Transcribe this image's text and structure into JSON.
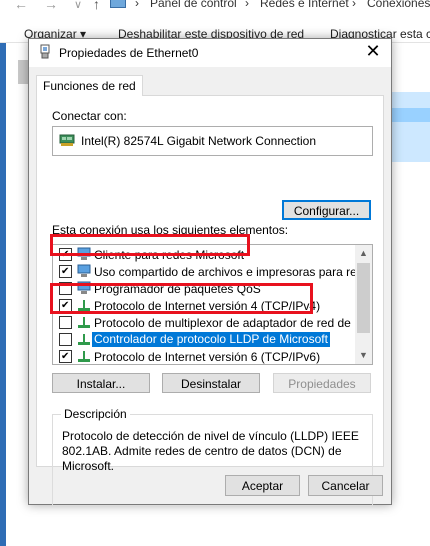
{
  "background": {
    "nav": {
      "back": "←",
      "forward": "→",
      "dropdown": "∨",
      "up": "↑"
    },
    "breadcrumb": {
      "sep1": "›",
      "item1": "Panel de control",
      "sep2": "›",
      "item2": "Redes e Internet",
      "sep3": "›",
      "item3": "Conexiones"
    },
    "toolbar": {
      "organize": "Organizar ▾",
      "disable": "Deshabilitar este dispositivo de red",
      "diagnose": "Diagnosticar esta c"
    }
  },
  "dialog": {
    "title": "Propiedades de Ethernet0",
    "close": "✕",
    "tab": "Funciones de red",
    "connect_label": "Conectar con:",
    "adapter": "Intel(R) 82574L Gigabit Network Connection",
    "configure_button": "Configurar...",
    "items_label": "Esta conexión usa los siguientes elementos:",
    "items": [
      {
        "label": "Cliente para redes Microsoft",
        "checked": true,
        "icon": "network-client-icon"
      },
      {
        "label": "Uso compartido de archivos e impresoras para redes M",
        "checked": true,
        "icon": "network-service-icon"
      },
      {
        "label": "Programador de paquetes QoS",
        "checked": false,
        "icon": "network-service-icon"
      },
      {
        "label": "Protocolo de Internet versión 4 (TCP/IPv4)",
        "checked": true,
        "icon": "protocol-icon"
      },
      {
        "label": "Protocolo de multiplexor de adaptador de red de Micros",
        "checked": false,
        "icon": "protocol-icon"
      },
      {
        "label": "Controlador de protocolo LLDP de Microsoft",
        "checked": false,
        "icon": "protocol-icon",
        "selected": true
      },
      {
        "label": "Protocolo de Internet versión 6 (TCP/IPv6)",
        "checked": true,
        "icon": "protocol-icon"
      }
    ],
    "install_button": "Instalar...",
    "uninstall_button": "Desinstalar",
    "properties_button": "Propiedades",
    "description_label": "Descripción",
    "description": "Protocolo de detección de nivel de vínculo (LLDP) IEEE 802.1AB. Admite redes de centro de datos (DCN) de Microsoft.",
    "ok_button": "Aceptar",
    "cancel_button": "Cancelar"
  },
  "colors": {
    "accent": "#0078d7",
    "highlight_box": "#e8111e",
    "selection": "#0078d7"
  }
}
